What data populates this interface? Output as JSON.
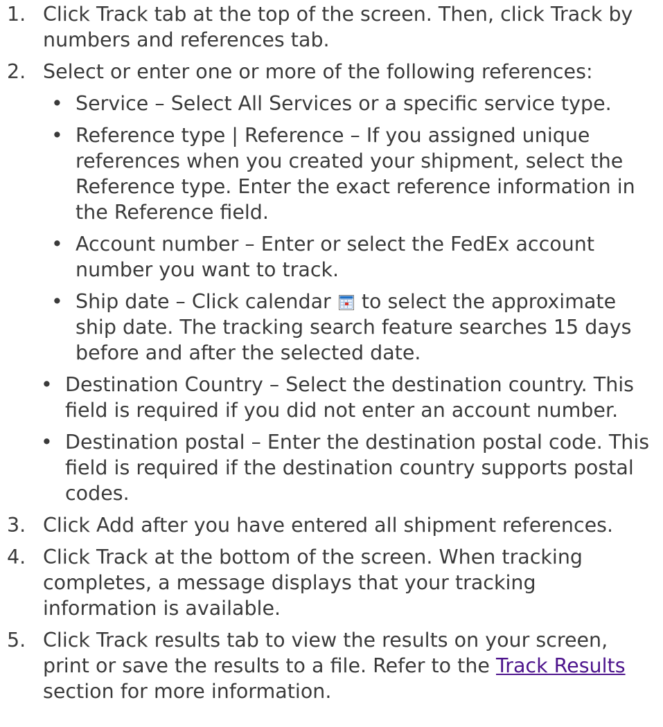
{
  "steps": [
    {
      "num": "1.",
      "text": "Click Track tab at the top of the screen. Then, click Track by numbers and references tab."
    },
    {
      "num": "2.",
      "text": "Select or enter one or more of the following references:",
      "bullets": [
        {
          "dot": "•",
          "text": "Service – Select All Services or a specific service type."
        },
        {
          "dot": "•",
          "text": "Reference type | Reference – If you assigned unique references when you created your shipment, select the Reference type. Enter the exact reference information in the Reference field."
        },
        {
          "dot": "•",
          "text": "Account number – Enter or select the FedEx account number you want to track."
        },
        {
          "dot": "•",
          "text_before": "Ship date – Click calendar",
          "icon": "calendar-icon",
          "text_after": "to select the approximate ship date. The tracking search feature searches 15 days before and after the selected date."
        },
        {
          "dot": "•",
          "text": "Destination Country – Select the destination country. This field is required if you did not enter an account number."
        },
        {
          "dot": "•",
          "text": "Destination postal – Enter the destination postal code. This field is required if the destination country supports postal codes."
        }
      ]
    },
    {
      "num": "3.",
      "text": "Click Add after you have entered all shipment references."
    },
    {
      "num": "4.",
      "text": "Click Track at the bottom of the screen. When tracking completes, a message displays that your tracking information is available."
    },
    {
      "num": "5.",
      "text_before": "Click Track results tab to view the results on your screen, print or save the results to a file. Refer to the",
      "link": "Track Results",
      "text_after": "section for more information."
    }
  ],
  "colors": {
    "text": "#3a3a3a",
    "link": "#4d148c",
    "calendar_frame": "#1f6fc5",
    "calendar_marker": "#d9342b"
  }
}
